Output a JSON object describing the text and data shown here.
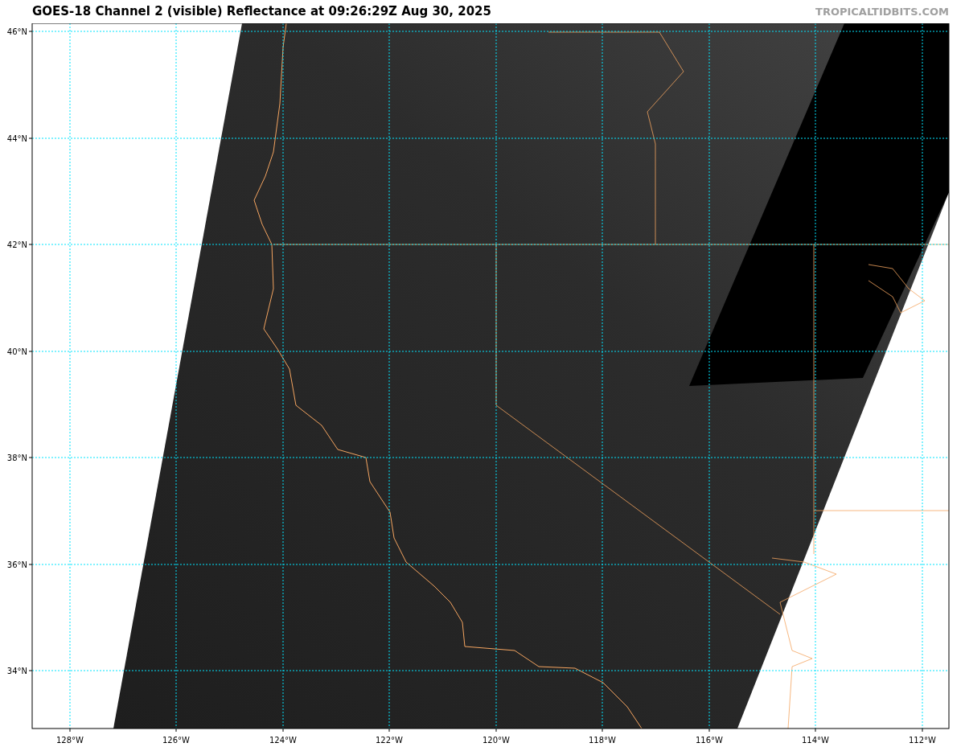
{
  "title": "GOES-18 Channel 2 (visible) Reflectance at 09:26:29Z Aug 30, 2025",
  "credit": "TROPICALTIDBITS.COM",
  "longitude_labels": [
    "128°W",
    "126°W",
    "124°W",
    "122°W",
    "120°W",
    "118°W",
    "116°W",
    "114°W",
    "112°W"
  ],
  "latitude_labels": [
    "46°N",
    "44°N",
    "42°N",
    "40°N",
    "38°N",
    "36°N",
    "34°N"
  ]
}
